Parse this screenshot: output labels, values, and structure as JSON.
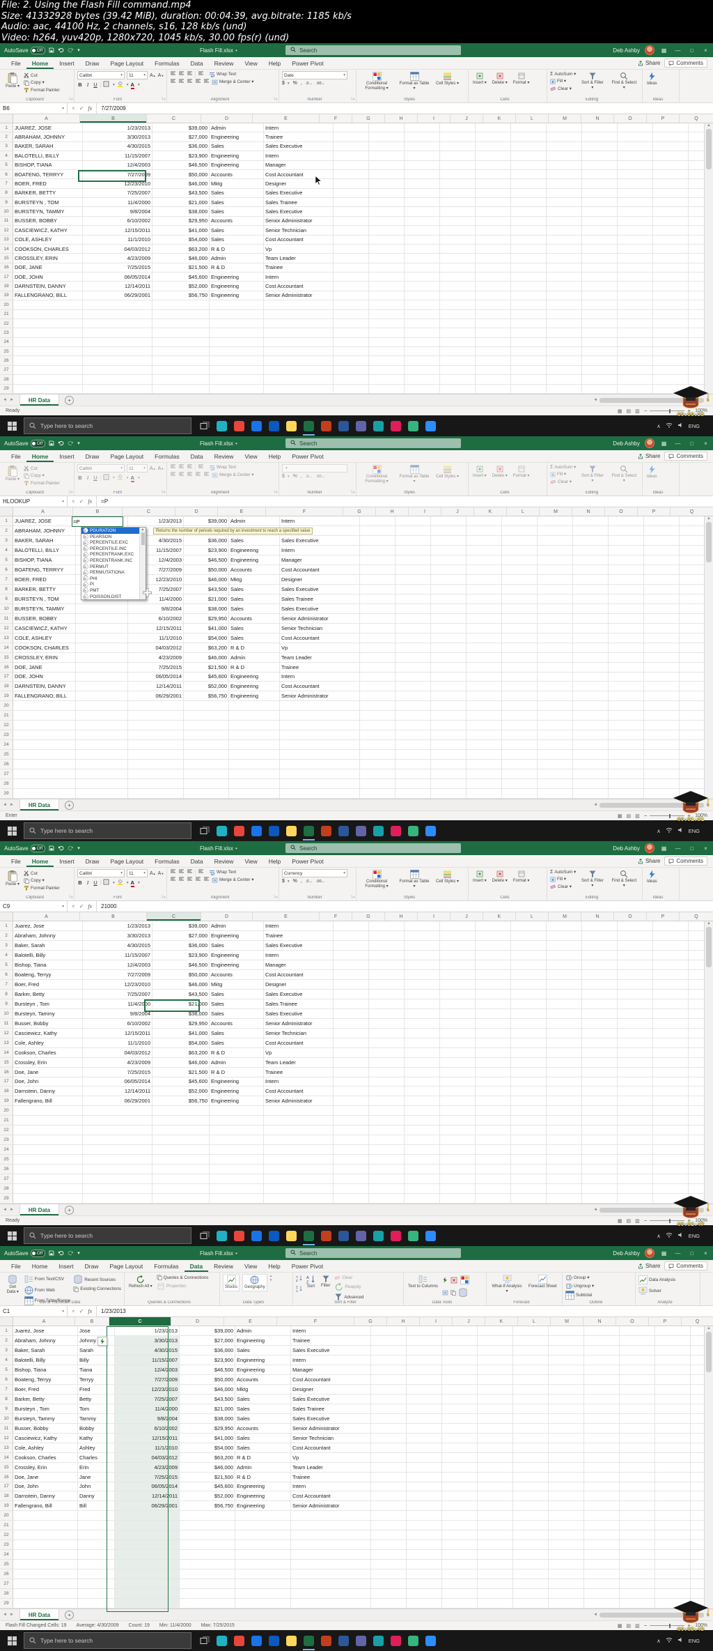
{
  "meta": {
    "lines": [
      "File: 2. Using the Flash Fill command.mp4",
      "Size: 41332928 bytes (39.42 MiB), duration: 00:04:39, avg.bitrate: 1185 kb/s",
      "Audio: aac, 44100 Hz, 2 channels, s16, 128 kb/s (und)",
      "Video: h264, yuv420p, 1280x720, 1045 kb/s, 30.00 fps(r) (und)"
    ]
  },
  "colors": {
    "excel_green": "#1e6c41",
    "accent": "#217346",
    "titlebar_search_bg": "#9cc0ad",
    "function_selected": "#1f6bd0",
    "tooltip_bg": "#fbf7d0",
    "taskbar_bg": "#171717",
    "selection_tint": "#e7eee9",
    "timestamp_yellow": "#e8cf4e"
  },
  "app": {
    "autosave": {
      "label": "AutoSave",
      "state": "Off"
    },
    "workbook_title": "Flash Fill.xlsx",
    "saved_indicator": "•",
    "search_placeholder": "Search",
    "user_name": "Deb Ashby",
    "ribbon_tabs": [
      "File",
      "Home",
      "Insert",
      "Draw",
      "Page Layout",
      "Formulas",
      "Data",
      "Review",
      "View",
      "Help",
      "Power Pivot"
    ],
    "share_label": "Share",
    "comments_label": "Comments",
    "col_headers": [
      "A",
      "B",
      "C",
      "D",
      "E",
      "F",
      "G",
      "H",
      "I",
      "J",
      "K",
      "L",
      "M",
      "N",
      "O",
      "P",
      "Q"
    ],
    "sheet_tab": "HR Data",
    "home_ribbon": {
      "paste": "Paste",
      "cut": "Cut",
      "copy": "Copy",
      "format_painter": "Format Painter",
      "clipboard": "Clipboard",
      "font_name": "Calibri",
      "font_size": "11",
      "font": "Font",
      "wrap": "Wrap Text",
      "merge": "Merge & Center",
      "alignment": "Alignment",
      "number": "Number",
      "conditional_formatting": "Conditional Formatting",
      "format_as_table": "Format as Table",
      "cell_styles": "Cell Styles",
      "styles": "Styles",
      "insert": "Insert",
      "delete": "Delete",
      "format": "Format",
      "cells": "Cells",
      "autosum": "AutoSum",
      "fill": "Fill",
      "clear": "Clear",
      "sort_filter": "Sort & Filter",
      "find_select": "Find & Select",
      "editing": "Editing",
      "ideas": "Ideas"
    },
    "data_ribbon": {
      "get_data": "Get Data",
      "from_text": "From Text/CSV",
      "from_web": "From Web",
      "from_table": "From Table/Range",
      "recent": "Recent Sources",
      "existing": "Existing Connections",
      "group_get": "Get & Transform Data",
      "refresh": "Refresh All",
      "queries": "Queries & Connections",
      "properties": "Properties",
      "group_queries": "Queries & Connections",
      "stocks": "Stocks",
      "geography": "Geography",
      "group_types": "Data Types",
      "sort": "Sort",
      "filter": "Filter",
      "clear": "Clear",
      "re_apply": "Reapply",
      "advanced": "Advanced",
      "group_sort": "Sort & Filter",
      "text_to_columns": "Text to Columns",
      "group_tools": "Data Tools",
      "what_if": "What-If Analysis",
      "forecast_sheet": "Forecast Sheet",
      "group_forecast": "Forecast",
      "group_btn": "Group",
      "ungroup": "Ungroup",
      "subtotal": "Subtotal",
      "group_outline": "Outline",
      "data_analysis": "Data Analysis",
      "solver": "Solver",
      "group_analyze": "Analyze"
    },
    "taskbar": {
      "search_placeholder": "Type here to search",
      "language": "ENG",
      "app_colors": [
        "#20b2c4",
        "#e8453c",
        "#1a73e8",
        "#0a59c0",
        "#ffd75e",
        "#1d6f42",
        "#c43e1c",
        "#2b579a",
        "#6264a7",
        "#18a0a8",
        "#e01e5a",
        "#36b37e",
        "#2d8cff"
      ],
      "active_app_index": 5
    }
  },
  "employees": {
    "names_upper": [
      "JUAREZ, JOSE",
      "ABRAHAM, JOHNNY",
      "BAKER, SARAH",
      "BALOTELLI, BILLY",
      "BISHOP, TIANA",
      "BOATENG, TERRYY",
      "BOER, FRED",
      "BARKER, BETTY",
      "BURSTEYN , TOM",
      "BURSTEYN, TAMMY",
      "BUSSER, BOBBY",
      "CASCIEWICZ, KATHY",
      "COLE, ASHLEY",
      "COOKSON, CHARLES",
      "CROSSLEY, ERIN",
      "DOE, JANE",
      "DOE, JOHN",
      "DARNSTEIN, DANNY",
      "FALLENGRANO, BILL"
    ],
    "names_proper": [
      "Juarez, Jose",
      "Abraham, Johnny",
      "Baker, Sarah",
      "Balotelli, Billy",
      "Bishop, Tiana",
      "Boateng, Terryy",
      "Boer, Fred",
      "Barker, Betty",
      "Bursteyn , Tom",
      "Bursteyn, Tammy",
      "Busser, Bobby",
      "Casciewicz, Kathy",
      "Cole, Ashley",
      "Cookson, Charles",
      "Crossley, Erin",
      "Doe, Jane",
      "Doe, John",
      "Darnstein, Danny",
      "Fallengrano, Bill"
    ],
    "first_names": [
      "Jose",
      "Johnny",
      "Sarah",
      "Billy",
      "Tiana",
      "Terryy",
      "Fred",
      "Betty",
      "Tom",
      "Tammy",
      "Bobby",
      "Kathy",
      "Ashley",
      "Charles",
      "Erin",
      "Jane",
      "John",
      "Danny",
      "Bill"
    ],
    "hire_dates": [
      "1/23/2013",
      "3/30/2013",
      "4/30/2015",
      "11/15/2007",
      "12/4/2003",
      "7/27/2009",
      "12/23/2010",
      "7/25/2007",
      "11/4/2000",
      "9/8/2004",
      "6/10/2002",
      "12/15/2011",
      "11/1/2010",
      "04/03/2012",
      "4/23/2009",
      "7/25/2015",
      "06/05/2014",
      "12/14/2011",
      "06/29/2001"
    ],
    "salaries": [
      "$39,000",
      "$27,000",
      "$36,000",
      "$23,900",
      "$46,500",
      "$50,000",
      "$46,000",
      "$43,500",
      "$21,000",
      "$38,000",
      "$29,950",
      "$41,000",
      "$54,000",
      "$63,200",
      "$46,000",
      "$21,500",
      "$45,600",
      "$52,000",
      "$56,750"
    ],
    "departments": [
      "Admin",
      "Engineering",
      "Sales",
      "Engineering",
      "Engineering",
      "Accounts",
      "Mktg",
      "Sales",
      "Sales",
      "Sales",
      "Accounts",
      "Sales",
      "Sales",
      "R & D",
      "Admin",
      "R & D",
      "Engineering",
      "Engineering",
      "Engineering"
    ],
    "titles": [
      "Intern",
      "Trainee",
      "Sales Executive",
      "Intern",
      "Manager",
      "Cost Accountant",
      "Designer",
      "Sales Executive",
      "Sales Trainee",
      "Sales Executive",
      "Senior Administrator",
      "Senior Technician",
      "Cost Accountant",
      "Vp",
      "Team Leader",
      "Trainee",
      "Intern",
      "Cost Accountant",
      "Senior Administrator"
    ]
  },
  "frames": [
    {
      "active_tab": "Home",
      "name_box": "B6",
      "formula": "7/27/2009",
      "number_format": "Date",
      "status_left": "Ready",
      "zoom": "100%",
      "timestamp": "00:00:55"
    },
    {
      "active_tab": "Home",
      "name_box": "HLOOKUP",
      "formula": "=P",
      "number_format": "",
      "status_left": "Enter",
      "zoom": "100%",
      "timestamp": "00:01:51",
      "edit_text": "=P",
      "selected_function": "PDURATION",
      "function_list": [
        "PDURATION",
        "PEARSON",
        "PERCENTILE.EXC",
        "PERCENTILE.INC",
        "PERCENTRANK.EXC",
        "PERCENTRANK.INC",
        "PERMUT",
        "PERMUTATIONA",
        "PHI",
        "PI",
        "PMT",
        "POISSON.DIST"
      ],
      "function_tooltip": "Returns the number of periods required by an investment to reach a specified value"
    },
    {
      "active_tab": "Home",
      "name_box": "C9",
      "formula": "21000",
      "number_format": "Currency",
      "status_left": "Ready",
      "zoom": "100%",
      "timestamp": "00:02:47"
    },
    {
      "active_tab": "Data",
      "name_box": "C1",
      "formula": "1/23/2013",
      "status_left": "Flash Fill Changed Cells: 19",
      "aggregates": [
        "Average: 4/30/2009",
        "Count: 19",
        "Min: 11/4/2000",
        "Max: 7/25/2015"
      ],
      "zoom": "100%",
      "timestamp": "00:03:43"
    }
  ]
}
